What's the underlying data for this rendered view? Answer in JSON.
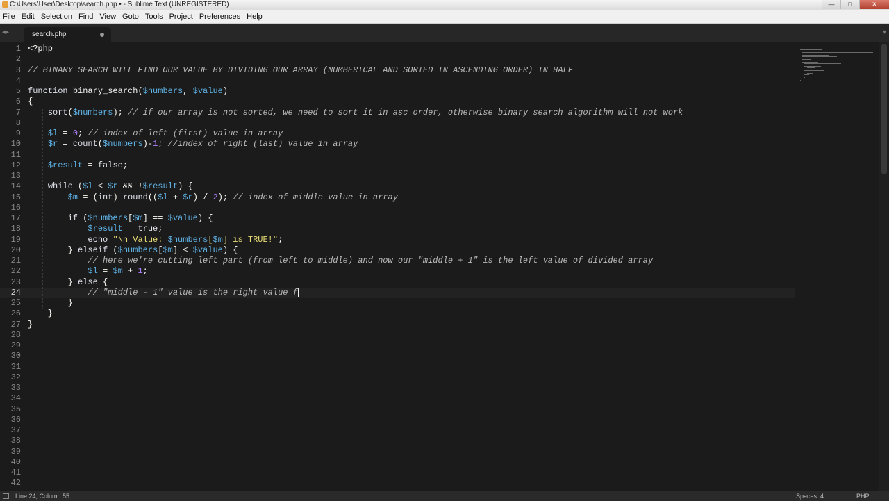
{
  "window": {
    "title": "C:\\Users\\User\\Desktop\\search.php • - Sublime Text (UNREGISTERED)",
    "buttons": {
      "minimize": "—",
      "maximize": "□",
      "close": "✕"
    }
  },
  "menu": [
    "File",
    "Edit",
    "Selection",
    "Find",
    "View",
    "Goto",
    "Tools",
    "Project",
    "Preferences",
    "Help"
  ],
  "tabs": {
    "active": "search.php",
    "nav_left": "◂▸",
    "nav_right": "▾"
  },
  "editor": {
    "current_line": 24,
    "line_numbers": [
      "1",
      "2",
      "3",
      "4",
      "5",
      "6",
      "7",
      "8",
      "9",
      "10",
      "11",
      "12",
      "13",
      "14",
      "15",
      "16",
      "17",
      "18",
      "19",
      "20",
      "21",
      "22",
      "23",
      "24",
      "25",
      "26",
      "27",
      "28",
      "29",
      "30",
      "31",
      "32",
      "33",
      "34",
      "35",
      "36",
      "37",
      "38",
      "39",
      "40",
      "41",
      "42"
    ],
    "lines": [
      "<?php",
      "",
      "// BINARY SEARCH WILL FIND OUR VALUE BY DIVIDING OUR ARRAY (NUMBERICAL AND SORTED IN ASCENDING ORDER) IN HALF",
      "",
      "function binary_search($numbers, $value)",
      "{",
      "    sort($numbers); // if our array is not sorted, we need to sort it in asc order, otherwise binary search algorithm will not work",
      "",
      "    $l = 0; // index of left (first) value in array",
      "    $r = count($numbers)-1; //index of right (last) value in array",
      "",
      "    $result = false;",
      "",
      "    while ($l < $r && !$result) {",
      "        $m = (int) round(($l + $r) / 2); // index of middle value in array",
      "",
      "        if ($numbers[$m] == $value) {",
      "            $result = true;",
      "            echo \"\\n Value: $numbers[$m] is TRUE!\";",
      "        } elseif ($numbers[$m] < $value) {",
      "            // here we're cutting left part (from left to middle) and now our \"middle + 1\" is the left value of divided array",
      "            $l = $m + 1;",
      "        } else {",
      "            // \"middle - 1\" value is the right value f",
      "        }",
      "    }",
      "}"
    ]
  },
  "status": {
    "position": "Line 24, Column 55",
    "indentation": "Spaces: 4",
    "syntax": "PHP"
  }
}
